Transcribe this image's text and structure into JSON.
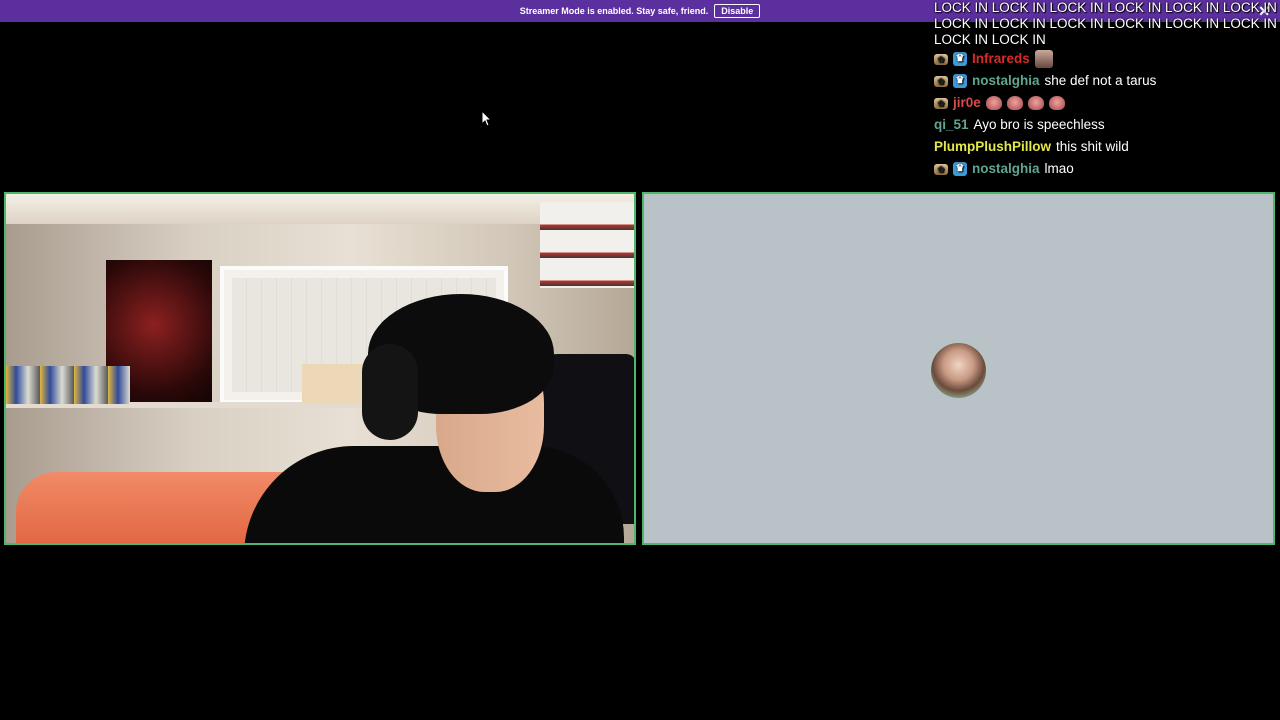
{
  "banner": {
    "text": "Streamer Mode is enabled. Stay safe, friend.",
    "button_label": "Disable",
    "close_glyph": "✕"
  },
  "chat": {
    "spam_text": "LOCK IN LOCK IN LOCK IN LOCK IN LOCK IN LOCK IN LOCK IN LOCK IN LOCK IN LOCK IN LOCK IN LOCK IN LOCK IN LOCK IN",
    "messages": [
      {
        "user": "Infrareds",
        "color": "#d92a2a",
        "message": ""
      },
      {
        "user": "nostalghia",
        "color": "#5fa592",
        "message": "she def not a tarus"
      },
      {
        "user": "jir0e",
        "color": "#d94a4a",
        "message": ""
      },
      {
        "user": "qi_51",
        "color": "#5fa592",
        "message": "Ayo bro is speechless"
      },
      {
        "user": "PlumpPlushPillow",
        "color": "#e4e84a",
        "message": "this shit wild"
      },
      {
        "user": "nostalghia",
        "color": "#5fa592",
        "message": "lmao"
      }
    ]
  },
  "tiles": {
    "left": {
      "border_color": "#4db86b"
    },
    "right": {
      "border_color": "#4db86b",
      "background": "#b8c2c7"
    }
  }
}
